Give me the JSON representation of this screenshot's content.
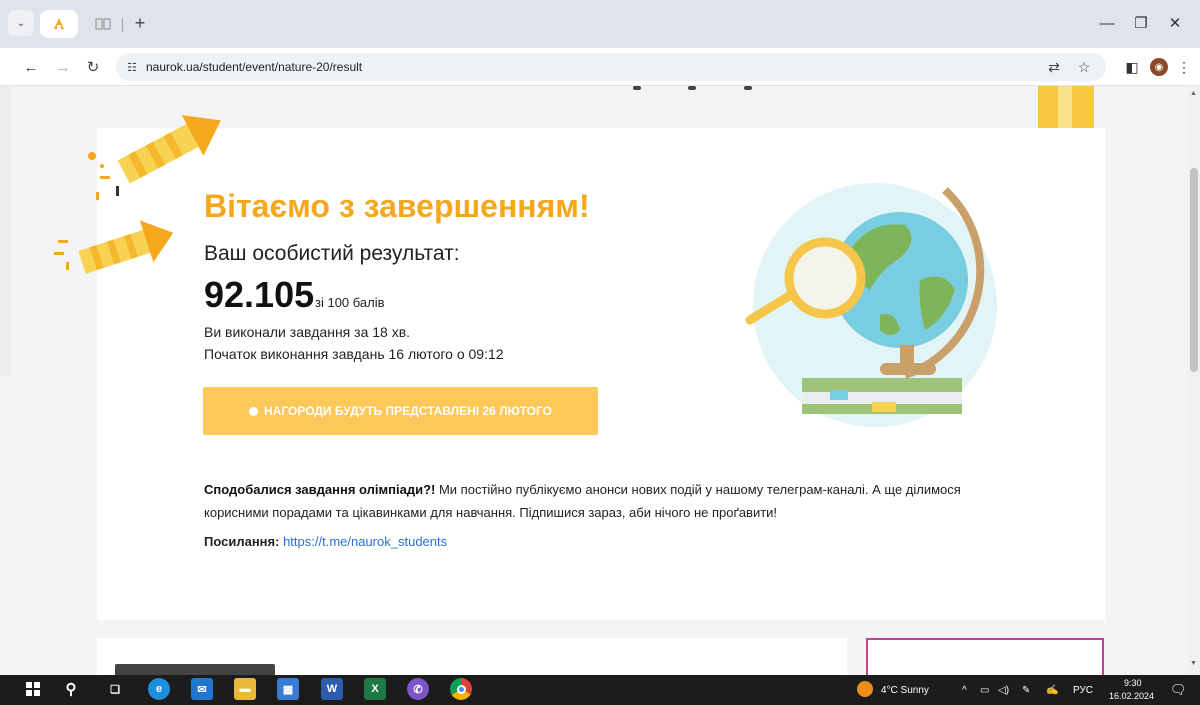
{
  "browser": {
    "url": "naurok.ua/student/event/nature-20/result",
    "new_tab_symbol": "+"
  },
  "page": {
    "title": "Вітаємо з завершенням!",
    "subtitle": "Ваш особистий результат:",
    "score": "92.105",
    "score_suffix": "зі 100 балів",
    "time_info": "Ви виконали завдання за 18 хв.",
    "start_info": "Початок виконання завдань 16 лютого о 09:12",
    "award_button": "НАГОРОДИ БУДУТЬ ПРЕДСТАВЛЕНІ 26 ЛЮТОГО",
    "promo_bold": "Сподобалися завдання олімпіади?!",
    "promo_text": " Ми постійно публікуємо анонси нових подій у нашому телеграм-каналі. А ще ділимося корисними порадами та цікавинками для навчання. Підпишися зараз, аби нічого не проґавити!",
    "link_label": "Посилання:",
    "link_url": "https://t.me/naurok_students"
  },
  "colors": {
    "title": "#f5a81c",
    "button": "#fcc85a",
    "link": "#2b6fd6"
  },
  "taskbar": {
    "weather": "4°C Sunny",
    "language": "РУС",
    "time": "9:30",
    "date": "16.02.2024",
    "apps": [
      "windows-start",
      "search",
      "task-view",
      "edge",
      "mail",
      "file-explorer",
      "store",
      "word",
      "excel",
      "viber",
      "chrome"
    ]
  }
}
